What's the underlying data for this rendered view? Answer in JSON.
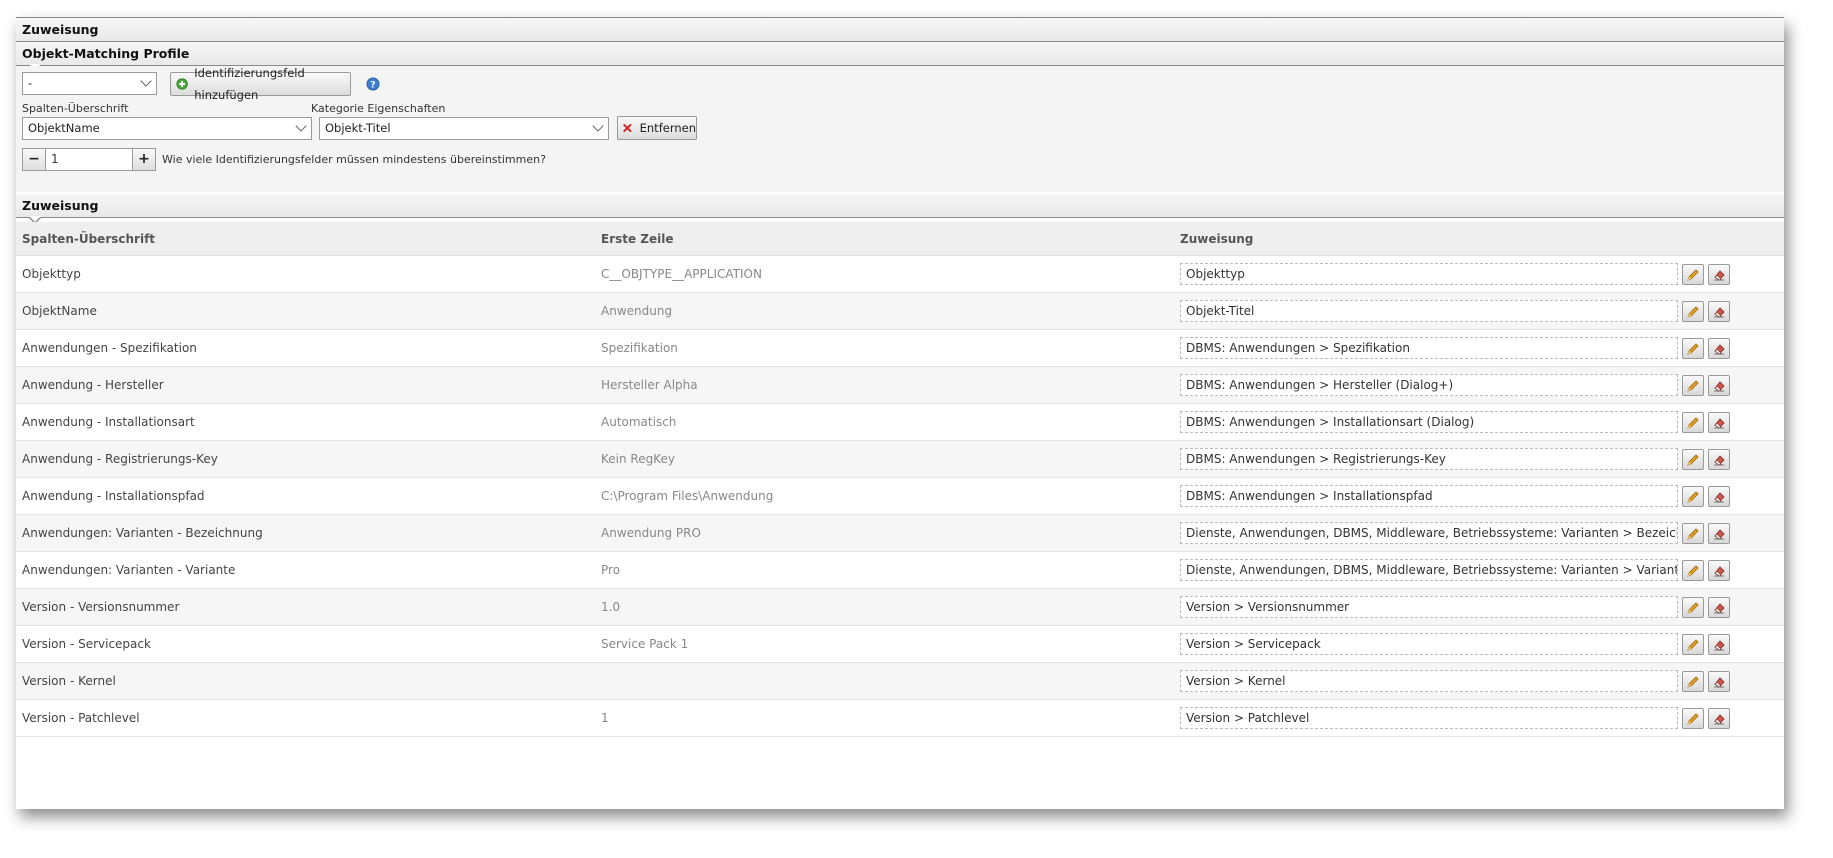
{
  "sections": {
    "top_title": "Zuweisung",
    "profile_title": "Objekt-Matching Profile",
    "assignment_title": "Zuweisung"
  },
  "profile": {
    "profile_select": "-",
    "add_button": "Identifizierungsfeld hinzufügen",
    "column_label": "Spalten-Überschrift",
    "category_label": "Kategorie Eigenschaften",
    "column_select": "ObjektName",
    "category_select": "Objekt-Titel",
    "remove_button": "Entfernen",
    "stepper_minus": "−",
    "stepper_value": "1",
    "stepper_plus": "+",
    "stepper_question": "Wie viele Identifizierungsfelder müssen mindestens übereinstimmen?"
  },
  "table": {
    "headers": [
      "Spalten-Überschrift",
      "Erste Zeile",
      "Zuweisung"
    ],
    "rows": [
      {
        "column": "Objekttyp",
        "first": "C__OBJTYPE__APPLICATION",
        "assign": "Objekttyp"
      },
      {
        "column": "ObjektName",
        "first": "Anwendung",
        "assign": "Objekt-Titel"
      },
      {
        "column": "Anwendungen - Spezifikation",
        "first": "Spezifikation",
        "assign": "DBMS: Anwendungen > Spezifikation"
      },
      {
        "column": "Anwendung - Hersteller",
        "first": "Hersteller Alpha",
        "assign": "DBMS: Anwendungen > Hersteller (Dialog+)"
      },
      {
        "column": "Anwendung - Installationsart",
        "first": "Automatisch",
        "assign": "DBMS: Anwendungen > Installationsart (Dialog)"
      },
      {
        "column": "Anwendung - Registrierungs-Key",
        "first": "Kein RegKey",
        "assign": "DBMS: Anwendungen > Registrierungs-Key"
      },
      {
        "column": "Anwendung - Installationspfad",
        "first": "C:\\Program Files\\Anwendung",
        "assign": "DBMS: Anwendungen > Installationspfad"
      },
      {
        "column": "Anwendungen: Varianten - Bezeichnung",
        "first": "Anwendung PRO",
        "assign": "Dienste, Anwendungen, DBMS, Middleware, Betriebssysteme: Varianten > Bezeichnung"
      },
      {
        "column": "Anwendungen: Varianten - Variante",
        "first": "Pro",
        "assign": "Dienste, Anwendungen, DBMS, Middleware, Betriebssysteme: Varianten > Variante"
      },
      {
        "column": "Version - Versionsnummer",
        "first": "1.0",
        "assign": "Version > Versionsnummer"
      },
      {
        "column": "Version - Servicepack",
        "first": "Service Pack 1",
        "assign": "Version > Servicepack"
      },
      {
        "column": "Version - Kernel",
        "first": "",
        "assign": "Version > Kernel"
      },
      {
        "column": "Version - Patchlevel",
        "first": "1",
        "assign": "Version > Patchlevel"
      }
    ]
  },
  "icons": {
    "add": "plus-circle-icon",
    "help": "help-icon",
    "remove": "red-x-icon",
    "edit": "pencil-icon",
    "clear": "eraser-icon"
  },
  "colors": {
    "add_icon_green": "#4aa83c",
    "help_icon_blue": "#3d7fd0",
    "remove_red": "#d42020",
    "pencil_orange": "#e8a020"
  }
}
